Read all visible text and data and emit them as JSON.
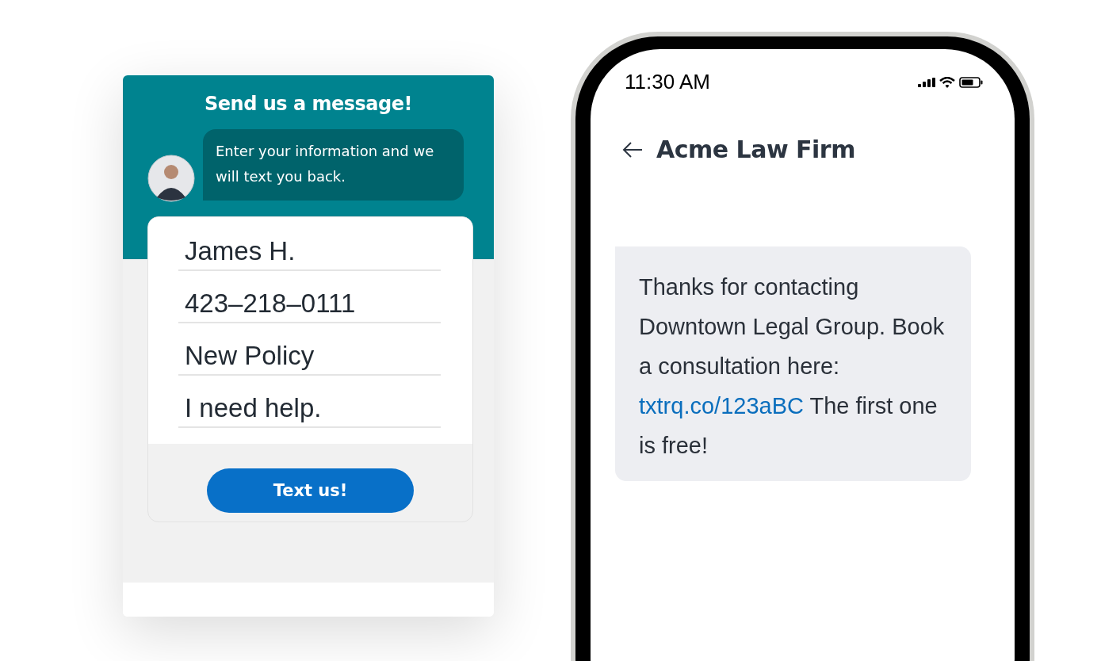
{
  "widget": {
    "title": "Send us a message!",
    "intro_message": "Enter your information and we will text you back.",
    "fields": [
      {
        "value": "James H."
      },
      {
        "value": "423–218–0111"
      },
      {
        "value": "New Policy"
      },
      {
        "value": "I need help."
      }
    ],
    "submit_button": "Text us!"
  },
  "phone": {
    "status_bar": {
      "time": "11:30 AM"
    },
    "header": {
      "title": "Acme Law Firm"
    },
    "messages": [
      {
        "text": "Thanks for contacting Downtown Legal Group. Book a consultation here:",
        "link": "txtrq.co/123aBC",
        "text_after": "The first one is free!"
      }
    ]
  }
}
